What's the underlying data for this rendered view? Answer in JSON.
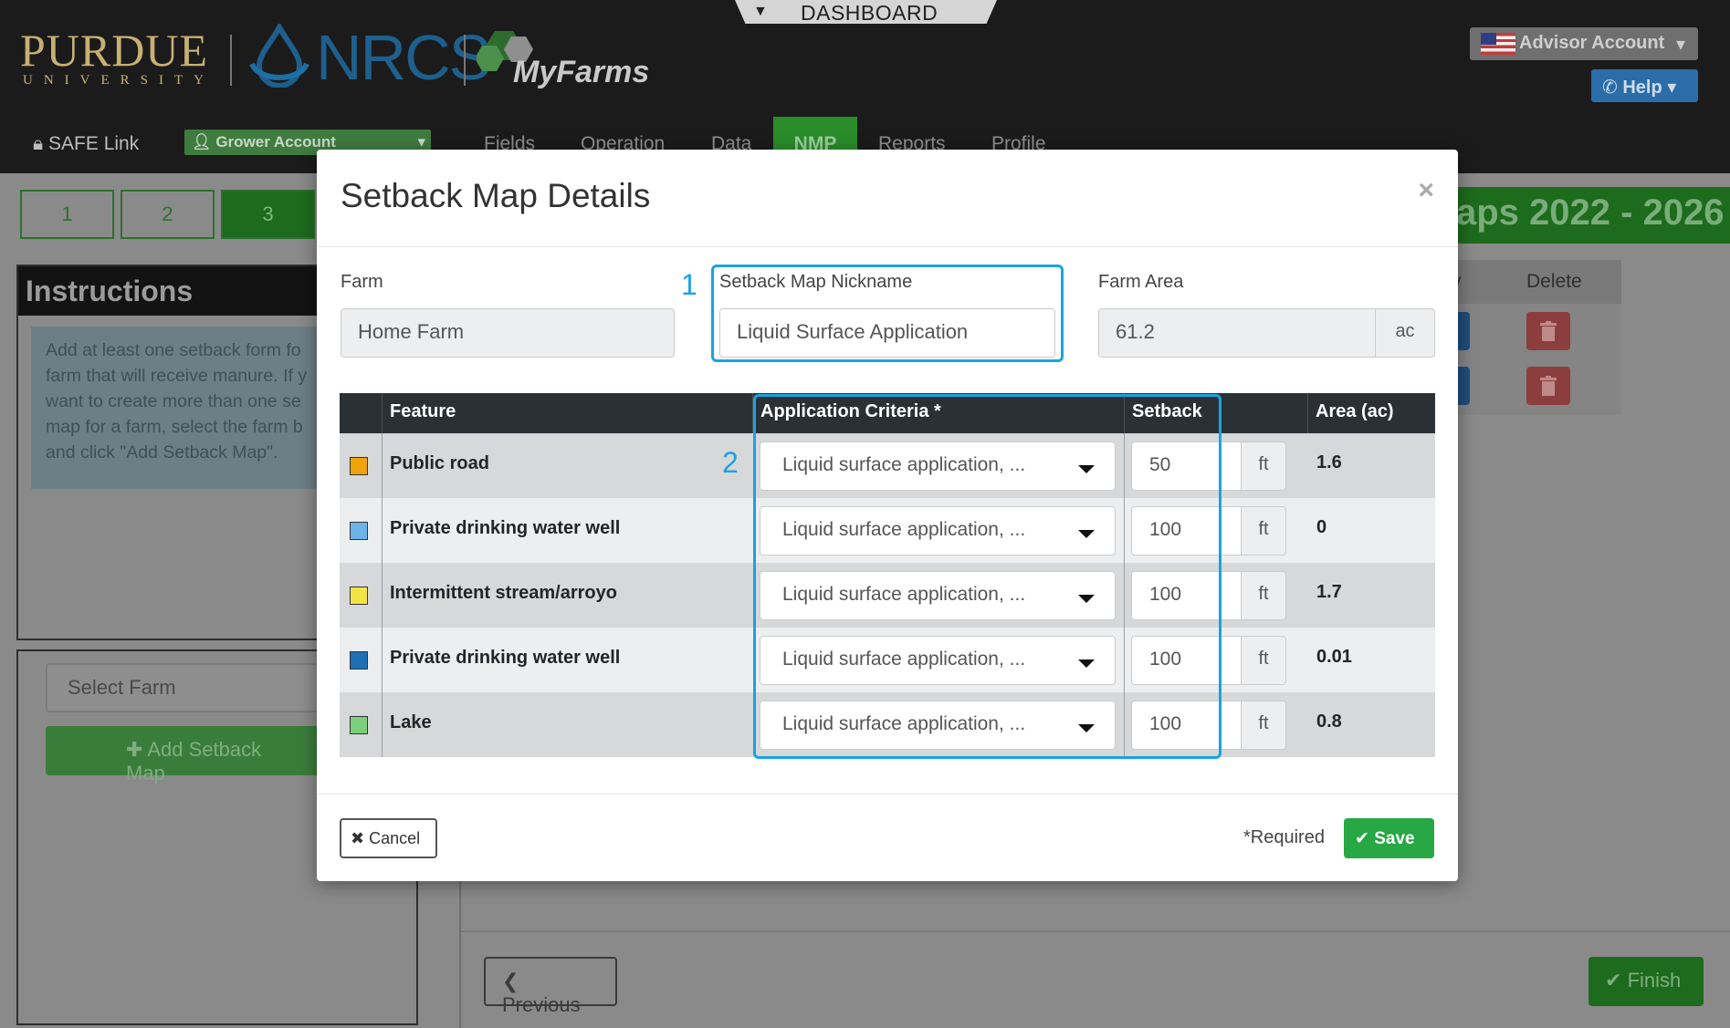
{
  "header": {
    "purdue": "PURDUE",
    "university": "UNIVERSITY",
    "nrcs": "NRCS",
    "myfarms": "MyFarms",
    "dashboard_tab": "DASHBOARD",
    "advisor_account": "Advisor Account",
    "help": "Help"
  },
  "nav": {
    "safe_link": "SAFE Link",
    "grower_account": "Grower Account",
    "items": [
      "Fields",
      "Operation",
      "Data",
      "NMP",
      "Reports",
      "Profile"
    ]
  },
  "background": {
    "steps": [
      "1",
      "2",
      "3"
    ],
    "instructions_title": "Instructions",
    "instructions_text": [
      "Add at least one setback form fo",
      "farm that will receive manure. If y",
      "want to create more than one se",
      "map for a farm, select the farm b",
      "and click \"Add Setback Map\"."
    ],
    "select_farm": "Select Farm",
    "add_setback_map": "Add Setback Map",
    "right_title": "aps 2022 - 2026",
    "col_v": "v",
    "col_delete": "Delete",
    "previous": "Previous",
    "finish": "Finish"
  },
  "modal": {
    "title": "Setback Map Details",
    "close": "×",
    "farm_label": "Farm",
    "farm_value": "Home Farm",
    "nickname_label": "Setback Map Nickname",
    "nickname_value": "Liquid Surface Application",
    "area_label": "Farm Area",
    "area_value": "61.2",
    "area_unit": "ac",
    "callout_1": "1",
    "callout_2": "2",
    "table": {
      "headers": {
        "feature": "Feature",
        "criteria": "Application Criteria *",
        "setback": "Setback",
        "area": "Area (ac)"
      },
      "rows": [
        {
          "color": "#f0a30a",
          "feature": "Public road",
          "criteria": "Liquid surface application, ...",
          "setback": "50",
          "unit": "ft",
          "area": "1.6"
        },
        {
          "color": "#6cb4e8",
          "feature": "Private drinking water well",
          "criteria": "Liquid surface application, ...",
          "setback": "100",
          "unit": "ft",
          "area": "0"
        },
        {
          "color": "#f3e445",
          "feature": "Intermittent stream/arroyo",
          "criteria": "Liquid surface application, ...",
          "setback": "100",
          "unit": "ft",
          "area": "1.7"
        },
        {
          "color": "#1f6fb5",
          "feature": "Private drinking water well",
          "criteria": "Liquid surface application, ...",
          "setback": "100",
          "unit": "ft",
          "area": "0.01"
        },
        {
          "color": "#7ccf7c",
          "feature": "Lake",
          "criteria": "Liquid surface application, ...",
          "setback": "100",
          "unit": "ft",
          "area": "0.8"
        }
      ]
    },
    "cancel": "Cancel",
    "required_note": "*Required",
    "save": "Save"
  }
}
